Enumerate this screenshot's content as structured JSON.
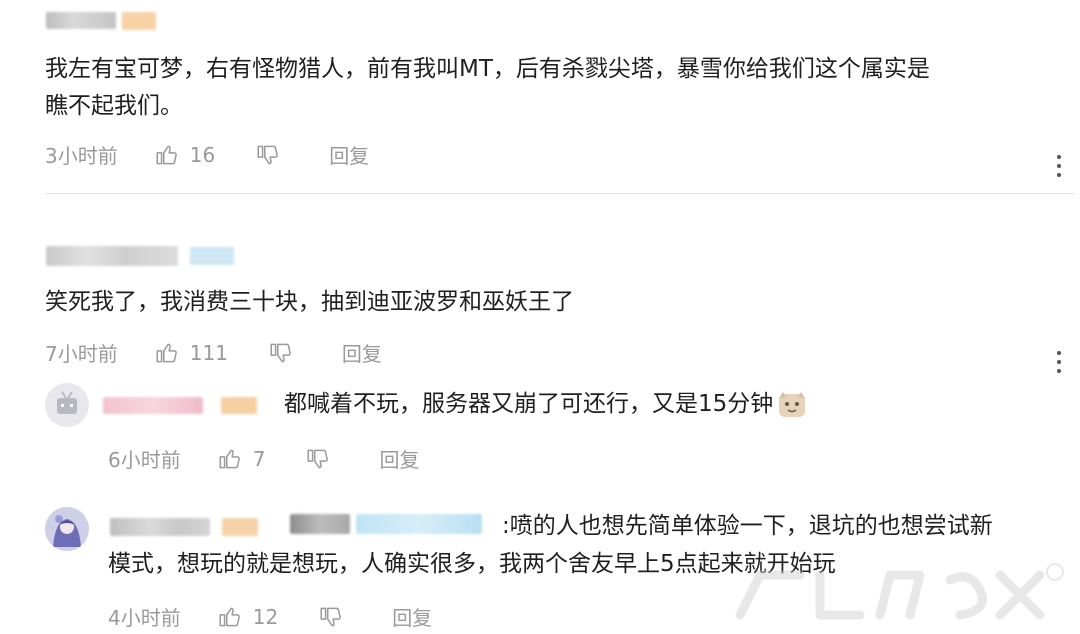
{
  "comments": [
    {
      "text": "我左有宝可梦，右有怪物猎人，前有我叫MT，后有杀戮尖塔，暴雪你给我们这个属实是瞧不起我们。",
      "line1": "我左有宝可梦，右有怪物猎人，前有我叫MT，后有杀戮尖塔，暴雪你给我们这个属实是",
      "line2": "瞧不起我们。",
      "time": "3小时前",
      "likes": "16",
      "reply_label": "回复"
    },
    {
      "text": "笑死我了，我消费三十块，抽到迪亚波罗和巫妖王了",
      "time": "7小时前",
      "likes": "111",
      "reply_label": "回复"
    }
  ],
  "replies": [
    {
      "text": "都喊着不玩，服务器又崩了可还行，又是15分钟",
      "time": "6小时前",
      "likes": "7",
      "reply_label": "回复"
    },
    {
      "line1": ":喷的人也想先简单体验一下，退坑的也想尝试新",
      "line2": "模式，想玩的就是想玩，人确实很多，我两个舍友早上5点起来就开始玩",
      "time": "4小时前",
      "likes": "12",
      "reply_label": "回复"
    }
  ],
  "colors": {
    "text": "#1f1f1f",
    "meta": "#999999",
    "divider": "#e6e6e6"
  },
  "icons": [
    "thumb-up-icon",
    "thumb-down-icon",
    "more-vertical-icon",
    "avatar-tv-icon",
    "avatar-anime-icon",
    "emoji-face-icon"
  ]
}
